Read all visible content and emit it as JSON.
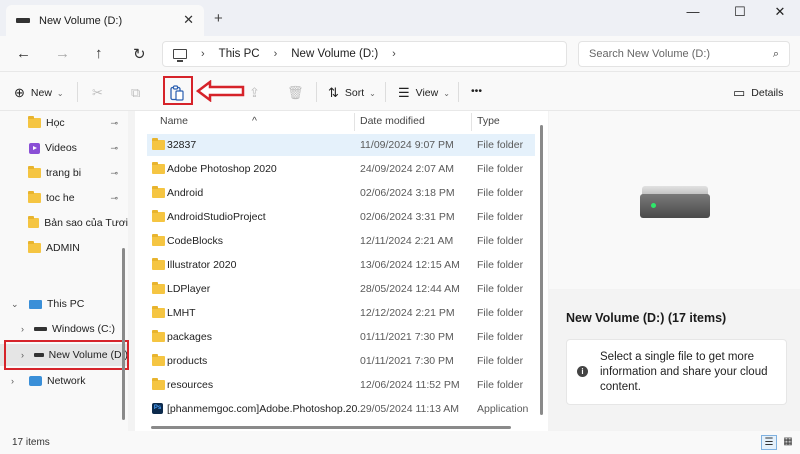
{
  "window": {
    "tab_title": "New Volume (D:)",
    "close_tab": "✕",
    "new_tab": "+",
    "minimize": "—",
    "maximize": "☐",
    "close": "✕"
  },
  "nav": {
    "back": "←",
    "forward": "→",
    "up": "↑",
    "refresh": "↻",
    "breadcrumb": [
      "This PC",
      "New Volume (D:)"
    ],
    "search_placeholder": "Search New Volume (D:)"
  },
  "commands": {
    "new_label": "New",
    "sort_label": "Sort",
    "view_label": "View",
    "more_label": "•••",
    "details_label": "Details",
    "icons": {
      "new": "⊕",
      "cut": "✂",
      "copy": "⧉",
      "paste": "📋",
      "rename": "✎",
      "share": "⇪",
      "delete": "🗑",
      "sort": "⇅",
      "view": "☰",
      "details": "▭"
    }
  },
  "navpane": {
    "quick_access": [
      {
        "label": "Học",
        "icon": "folder",
        "pinned": true
      },
      {
        "label": "Videos",
        "icon": "videos",
        "pinned": true
      },
      {
        "label": "trang bi",
        "icon": "folder",
        "pinned": true
      },
      {
        "label": "toc he",
        "icon": "folder",
        "pinned": true
      },
      {
        "label": "Bản sao của Tươi",
        "icon": "folder",
        "pinned": false
      },
      {
        "label": "ADMIN",
        "icon": "folder",
        "pinned": false
      }
    ],
    "this_pc": "This PC",
    "windows_c": "Windows (C:)",
    "new_volume_d": "New Volume (D:)",
    "network": "Network",
    "pin_glyph": "📌",
    "expand_open": "⌄",
    "expand_closed": "›"
  },
  "filelist": {
    "columns": {
      "name": "Name",
      "date": "Date modified",
      "type": "Type"
    },
    "rows": [
      {
        "name": "32837",
        "date": "11/09/2024 9:07 PM",
        "type": "File folder",
        "icon": "folder",
        "selected": true
      },
      {
        "name": "Adobe Photoshop 2020",
        "date": "24/09/2024 2:07 AM",
        "type": "File folder",
        "icon": "folder",
        "selected": false
      },
      {
        "name": "Android",
        "date": "02/06/2024 3:18 PM",
        "type": "File folder",
        "icon": "folder",
        "selected": false
      },
      {
        "name": "AndroidStudioProject",
        "date": "02/06/2024 3:31 PM",
        "type": "File folder",
        "icon": "folder",
        "selected": false
      },
      {
        "name": "CodeBlocks",
        "date": "12/11/2024 2:21 AM",
        "type": "File folder",
        "icon": "folder",
        "selected": false
      },
      {
        "name": "Illustrator 2020",
        "date": "13/06/2024 12:15 AM",
        "type": "File folder",
        "icon": "folder",
        "selected": false
      },
      {
        "name": "LDPlayer",
        "date": "28/05/2024 12:44 AM",
        "type": "File folder",
        "icon": "folder",
        "selected": false
      },
      {
        "name": "LMHT",
        "date": "12/12/2024 2:21 PM",
        "type": "File folder",
        "icon": "folder",
        "selected": false
      },
      {
        "name": "packages",
        "date": "01/11/2021 7:30 PM",
        "type": "File folder",
        "icon": "folder",
        "selected": false
      },
      {
        "name": "products",
        "date": "01/11/2021 7:30 PM",
        "type": "File folder",
        "icon": "folder",
        "selected": false
      },
      {
        "name": "resources",
        "date": "12/06/2024 11:52 PM",
        "type": "File folder",
        "icon": "folder",
        "selected": false
      },
      {
        "name": "[phanmemgoc.com]Adobe.Photoshop.20...",
        "date": "29/05/2024 11:13 AM",
        "type": "Application",
        "icon": "ps",
        "selected": false
      }
    ]
  },
  "details": {
    "title": "New Volume (D:) (17 items)",
    "message": "Select a single file to get more information and share your cloud content.",
    "info_glyph": "i"
  },
  "status": {
    "count": "17 items",
    "details_view": "☰",
    "tiles_view": "▦"
  },
  "colors": {
    "highlight_red": "#d6232a",
    "selection_blue": "#e5f1fb",
    "folder_yellow": "#f5c542"
  }
}
